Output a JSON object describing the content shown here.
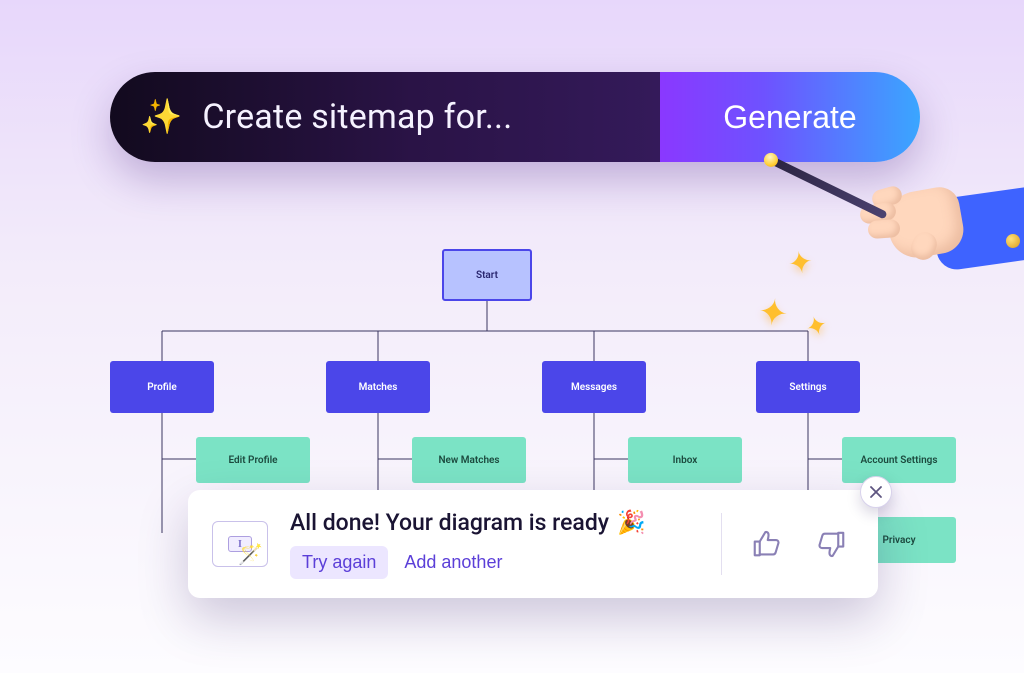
{
  "search": {
    "placeholder": "Create sitemap for...",
    "generate_label": "Generate"
  },
  "diagram": {
    "start": "Start",
    "categories": [
      "Profile",
      "Matches",
      "Messages",
      "Settings"
    ],
    "children": {
      "Profile": [
        "Edit Profile"
      ],
      "Matches": [
        "New Matches"
      ],
      "Messages": [
        "Inbox"
      ],
      "Settings": [
        "Account Settings",
        "Privacy"
      ]
    }
  },
  "toast": {
    "title": "All done! Your diagram is ready",
    "emoji": "🎉",
    "try_again": "Try again",
    "add_another": "Add another"
  },
  "chart_data": {
    "type": "tree",
    "root": "Start",
    "children": [
      {
        "name": "Profile",
        "children": [
          "Edit Profile"
        ]
      },
      {
        "name": "Matches",
        "children": [
          "New Matches"
        ]
      },
      {
        "name": "Messages",
        "children": [
          "Inbox"
        ]
      },
      {
        "name": "Settings",
        "children": [
          "Account Settings",
          "Privacy"
        ]
      }
    ]
  }
}
